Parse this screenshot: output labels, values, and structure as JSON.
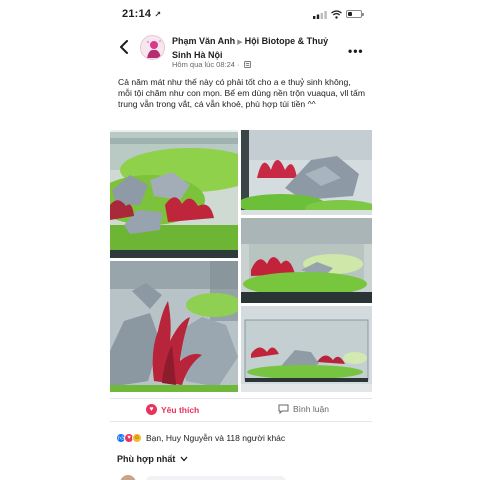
{
  "status_bar": {
    "time": "21:14",
    "time_arrow": "↗"
  },
  "post": {
    "author": "Phạm Văn Anh",
    "group": "Hội Biotope & Thuỷ Sinh Hà Nội",
    "timestamp": "Hôm qua lúc 08:24 ·",
    "text": "Cả năm mát như thế này có phải tốt cho a e thuỷ sinh không, mỗi tội chăm như con mọn. Bể em dùng nền trộn vuaqua, vll tấm trung vẫn trong vắt, cá vẫn khoẻ, phù hợp túi tiền ^^",
    "photos": [
      "aquascape-photo-1",
      "aquascape-photo-2",
      "aquascape-photo-3",
      "aquascape-photo-4",
      "aquascape-photo-5"
    ]
  },
  "actions": {
    "like_label": "Yêu thích",
    "comment_label": "Bình luận"
  },
  "reactions": {
    "summary": "Bạn, Huy Nguyễn và 118 người khác"
  },
  "comments": {
    "filter_label": "Phù hợp nhất"
  },
  "colors": {
    "accent": "#e8335c",
    "link": "#1877f2",
    "muted": "#65676b"
  },
  "icons": [
    "back-icon",
    "more-icon",
    "globe-icon",
    "heart-icon",
    "comment-icon",
    "chevron-down-icon",
    "signal-icon",
    "wifi-icon",
    "battery-icon"
  ]
}
